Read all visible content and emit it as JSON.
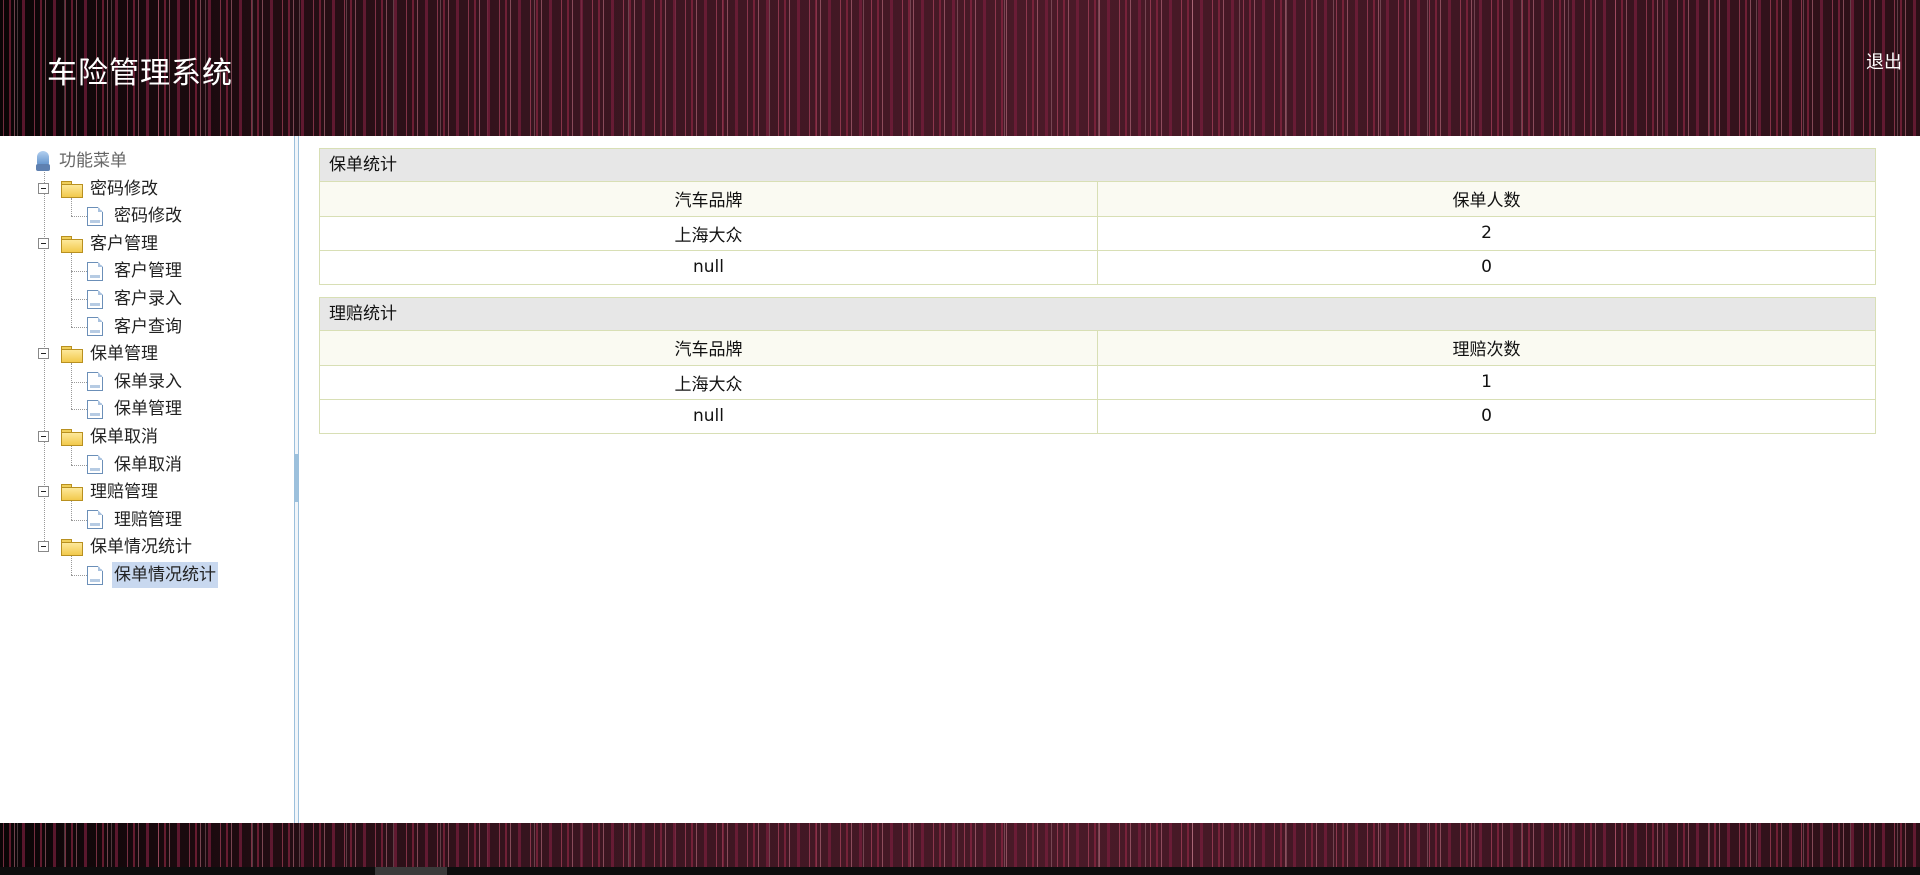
{
  "header": {
    "title": "车险管理系统",
    "logout_label": "退出"
  },
  "sidebar": {
    "root_label": "功能菜单",
    "groups": [
      {
        "label": "密码修改",
        "items": [
          {
            "label": "密码修改"
          }
        ]
      },
      {
        "label": "客户管理",
        "items": [
          {
            "label": "客户管理"
          },
          {
            "label": "客户录入"
          },
          {
            "label": "客户查询"
          }
        ]
      },
      {
        "label": "保单管理",
        "items": [
          {
            "label": "保单录入"
          },
          {
            "label": "保单管理"
          }
        ]
      },
      {
        "label": "保单取消",
        "items": [
          {
            "label": "保单取消"
          }
        ]
      },
      {
        "label": "理赔管理",
        "items": [
          {
            "label": "理赔管理"
          }
        ]
      },
      {
        "label": "保单情况统计",
        "items": [
          {
            "label": "保单情况统计",
            "selected": true
          }
        ]
      }
    ]
  },
  "main": {
    "policy_stats": {
      "title": "保单统计",
      "columns": [
        "汽车品牌",
        "保单人数"
      ],
      "rows": [
        [
          "上海大众",
          "2"
        ],
        [
          "null",
          "0"
        ]
      ]
    },
    "claim_stats": {
      "title": "理赔统计",
      "columns": [
        "汽车品牌",
        "理赔次数"
      ],
      "rows": [
        [
          "上海大众",
          "1"
        ],
        [
          "null",
          "0"
        ]
      ]
    }
  },
  "colors": {
    "selected_bg": "#c8d8ef",
    "panel_title_bg": "#e7e7e7",
    "table_border": "#d8dfb5",
    "header_base": "#3a1520"
  }
}
